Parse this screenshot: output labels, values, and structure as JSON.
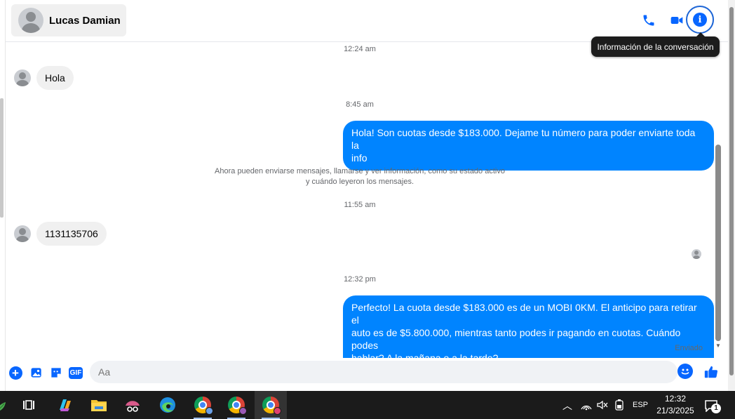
{
  "header": {
    "contact_name": "Lucas Damian",
    "tooltip": "Información de la conversación",
    "icons": [
      "phone-icon",
      "video-icon",
      "info-icon"
    ]
  },
  "messages": {
    "ts1": "12:24 am",
    "in1": "Hola",
    "ts2": "8:45 am",
    "out1_line1": "Hola! Son cuotas desde $183.000. Dejame tu número para poder enviarte toda la",
    "out1_line2": "info",
    "notice_line1": "Ahora pueden enviarse mensajes, llamarse y ver información, como su estado activo",
    "notice_line2": "y cuándo leyeron los mensajes.",
    "ts3": "11:55 am",
    "in2": "1131135706",
    "ts4": "12:32 pm",
    "out2_line1": "Perfecto! La cuota desde $183.000 es de un MOBI 0KM. El anticipo para retirar el",
    "out2_line2": "auto es de $5.800.000, mientras tanto podes ir pagando en cuotas. Cuándo podes",
    "out2_line3": "hablar? A la mañana o a la tarde?",
    "status": "Enviado"
  },
  "composer": {
    "placeholder": "Aa",
    "gif_label": "GIF"
  },
  "taskbar": {
    "language": "ESP",
    "time": "12:32",
    "date": "21/3/2025",
    "notification_count": "1"
  },
  "colors": {
    "accent": "#0866ff",
    "outgoing_bubble": "#0084ff",
    "incoming_bubble": "#f0f0f0"
  }
}
